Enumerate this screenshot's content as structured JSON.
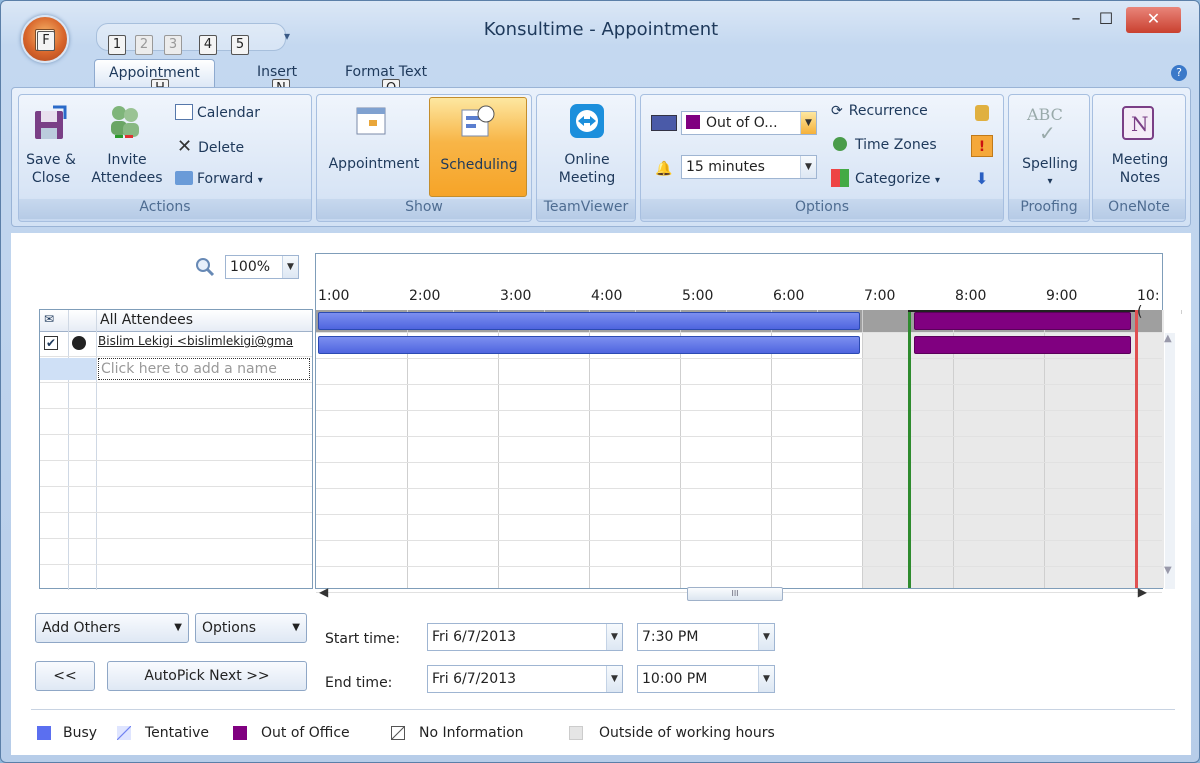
{
  "window": {
    "title": "Konsultime - Appointment",
    "minimize": "–",
    "maximize": "☐",
    "close": "✕"
  },
  "office_button": {
    "keytip": "F"
  },
  "qat_keytips": [
    "1",
    "2",
    "3",
    "4",
    "5"
  ],
  "tabs": [
    {
      "label": "Appointment",
      "keytip": "H"
    },
    {
      "label": "Insert",
      "keytip": "N"
    },
    {
      "label": "Format Text",
      "keytip": "O"
    }
  ],
  "ribbon": {
    "actions": {
      "label": "Actions",
      "save_close_1": "Save &",
      "save_close_2": "Close",
      "invite_1": "Invite",
      "invite_2": "Attendees",
      "calendar": "Calendar",
      "delete": "Delete",
      "forward": "Forward"
    },
    "show": {
      "label": "Show",
      "appointment": "Appointment",
      "scheduling": "Scheduling"
    },
    "teamviewer": {
      "label": "TeamViewer",
      "online_1": "Online",
      "online_2": "Meeting"
    },
    "options": {
      "label": "Options",
      "show_as": "Out of O...",
      "reminder": "15 minutes",
      "recurrence": "Recurrence",
      "time_zones": "Time Zones",
      "categorize": "Categorize"
    },
    "proofing": {
      "label": "Proofing",
      "spelling": "Spelling",
      "abc": "ABC"
    },
    "onenote": {
      "label": "OneNote",
      "notes_1": "Meeting",
      "notes_2": "Notes"
    }
  },
  "scheduler": {
    "zoom": "100%",
    "times": [
      "1:00",
      "2:00",
      "3:00",
      "4:00",
      "5:00",
      "6:00",
      "7:00",
      "8:00",
      "9:00",
      "10:("
    ],
    "all_attendees": "All Attendees",
    "attendee": "Bislim Lekigi <bislimlekigi@gma",
    "add_name": "Click here to add a name",
    "selection_start": "7:30 PM",
    "selection_end": "10:00 PM",
    "busy_until_hour": 7
  },
  "controls": {
    "add_others": "Add Others",
    "options": "Options",
    "prev": "<<",
    "autopick": "AutoPick Next >>",
    "start_label": "Start time:",
    "end_label": "End time:",
    "start_date": "Fri 6/7/2013",
    "start_time": "7:30 PM",
    "end_date": "Fri 6/7/2013",
    "end_time": "10:00 PM",
    "scroll_grip": "III"
  },
  "legend": {
    "busy": "Busy",
    "tentative": "Tentative",
    "ooo": "Out of Office",
    "noinfo": "No Information",
    "outside": "Outside of working hours"
  },
  "colors": {
    "busy": "#4f65df",
    "out_of_office": "#800080",
    "selection_start": "#2e8b2e",
    "selection_end": "#e05050",
    "outside_hours": "#e9e9e9"
  }
}
